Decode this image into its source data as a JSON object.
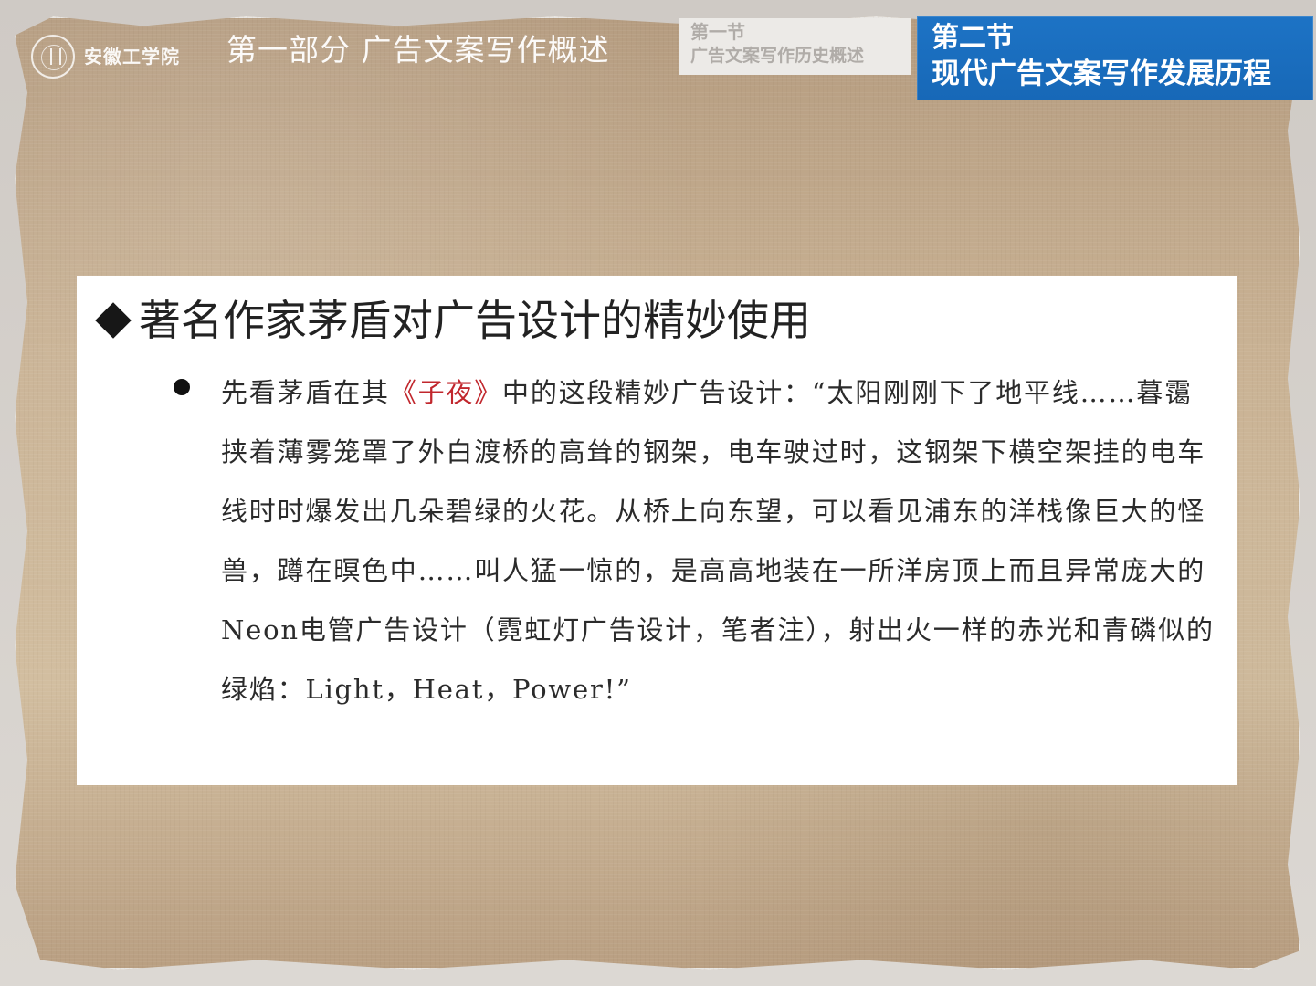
{
  "header": {
    "logo_text": "安徽工学院",
    "part_title": "第一部分 广告文案写作概述",
    "inactive_tab": {
      "line1": "第一节",
      "line2": "广告文案写作历史概述"
    },
    "active_tab": {
      "line1": "第二节",
      "line2": "现代广告文案写作发展历程"
    }
  },
  "content": {
    "heading": "著名作家茅盾对广告设计的精妙使用",
    "bullet": {
      "prefix": "先看茅盾在其",
      "emphasis": "《子夜》",
      "suffix": "中的这段精妙广告设计：“太阳刚刚下了地平线……暮霭挟着薄雾笼罩了外白渡桥的高耸的钢架，电车驶过时，这钢架下横空架挂的电车线时时爆发出几朵碧绿的火花。从桥上向东望，可以看见浦东的洋栈像巨大的怪兽，蹲在暝色中……叫人猛一惊的，是高高地装在一所洋房顶上而且异常庞大的Neon电管广告设计（霓虹灯广告设计，笔者注），射出火一样的赤光和青磷似的绿焰：Light，Heat，Power!”"
    }
  },
  "colors": {
    "active_tab": "#1d73c5",
    "emphasis": "#c1272d"
  },
  "icons": {
    "logo": "university-seal-icon",
    "heading_marker": "diamond-icon",
    "bullet_marker": "bullet-icon"
  }
}
